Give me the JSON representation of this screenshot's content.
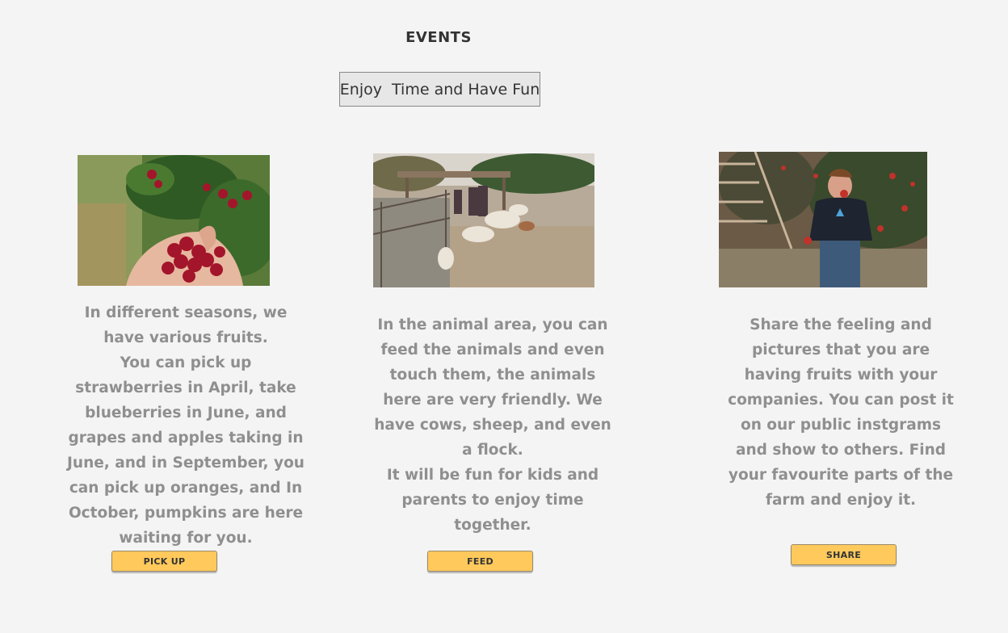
{
  "header": {
    "title": "EVENTS",
    "subtitle": "Enjoy  Time and Have Fun"
  },
  "cards": [
    {
      "image_name": "cherries-in-hand-photo",
      "lines": [
        "In different seasons, we have various fruits.",
        "You can pick up strawberries in April, take blueberries in June, and grapes and apples taking in June, and in September, you can pick up oranges, and In October, pumpkins are here waiting for you."
      ],
      "button_label": "PICK UP"
    },
    {
      "image_name": "family-feeding-sheep-photo",
      "lines": [
        "In the animal area, you can feed the animals and even touch them, the animals here are very friendly. We have cows, sheep, and even a flock.",
        "It will be fun for kids and parents to enjoy time together."
      ],
      "button_label": "FEED"
    },
    {
      "image_name": "boy-eating-apple-photo",
      "lines": [
        "Share the feeling and pictures that you are having fruits with your companies. You can post it on our public instgrams and show to others. Find your favourite parts of the farm and enjoy it."
      ],
      "button_label": "SHARE"
    }
  ],
  "colors": {
    "background": "#f4f4f4",
    "button": "#ffc95c",
    "body_text": "#8f8f8f",
    "heading_text": "#333333"
  }
}
